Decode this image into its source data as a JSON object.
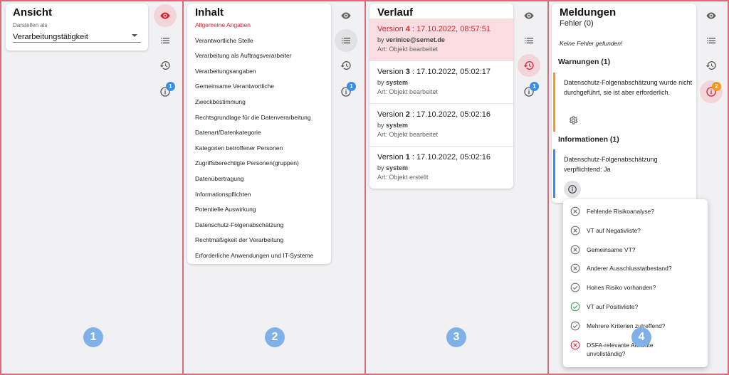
{
  "panels": [
    {
      "number": "1",
      "title": "Ansicht",
      "field_label": "Darstellen als",
      "field_value": "Verarbeitungstätigkeit"
    },
    {
      "number": "2",
      "title": "Inhalt",
      "items": [
        "Allgemeine Angaben",
        "Verantwortliche Stelle",
        "Verarbeitung als Auftragsverarbeiter",
        "Verarbeitungsangaben",
        "Gemeinsame Verantwortliche",
        "Zweckbestimmung",
        "Rechtsgrundlage für die Datenverarbeitung",
        "Datenart/Datenkategorie",
        "Kategorien betroffener Personen",
        "Zugriffsberechtigte Personen(gruppen)",
        "Datenübertragung",
        "Informationspflichten",
        "Potentielle Auswirkung",
        "Datenschutz-Folgenabschätzung",
        "Rechtmäßigkeit der Verarbeitung",
        "Erforderliche Anwendungen und IT-Systeme"
      ]
    },
    {
      "number": "3",
      "title": "Verlauf",
      "versions": [
        {
          "prefix": "Version ",
          "num": "4",
          "date": " : 17.10.2022, 08:57:51",
          "by": "by ",
          "user": "verinice@sernet.de",
          "art": "Art: Objekt bearbeitet"
        },
        {
          "prefix": "Version ",
          "num": "3",
          "date": " : 17.10.2022, 05:02:17",
          "by": "by ",
          "user": "system",
          "art": "Art: Objekt bearbeitet"
        },
        {
          "prefix": "Version ",
          "num": "2",
          "date": " : 17.10.2022, 05:02:16",
          "by": "by ",
          "user": "system",
          "art": "Art: Objekt bearbeitet"
        },
        {
          "prefix": "Version ",
          "num": "1",
          "date": " : 17.10.2022, 05:02:16",
          "by": "by ",
          "user": "system",
          "art": "Art: Objekt erstellt"
        }
      ]
    },
    {
      "number": "4",
      "title": "Meldungen",
      "errors_heading": "Fehler (0)",
      "no_errors": "Keine Fehler gefunden!",
      "warnings_heading": "Warnungen (1)",
      "warning_text": "Datenschutz-Folgenabschätzung wurde nicht durchgeführt, sie ist aber erforderlich.",
      "info_heading": "Informationen (1)",
      "info_text": "Datenschutz-Folgenabschätzung verpflichtend: Ja",
      "popup_items": [
        {
          "label": "Fehlende Risikoanalyse?",
          "state": "x-grey"
        },
        {
          "label": "VT auf Negativliste?",
          "state": "x-grey"
        },
        {
          "label": "Gemeinsame VT?",
          "state": "x-grey"
        },
        {
          "label": "Anderer Ausschlusstatbestand?",
          "state": "x-grey"
        },
        {
          "label": "Hohes Risiko vorhanden?",
          "state": "check-grey"
        },
        {
          "label": "VT auf Positivliste?",
          "state": "check-green"
        },
        {
          "label": "Mehrere Kriterien zutreffend?",
          "state": "check-grey"
        },
        {
          "label": "DSFA-relevante Attribute unvollständig?",
          "state": "x-red"
        }
      ]
    }
  ],
  "badges": {
    "info_count": "1",
    "warn_count": "2"
  },
  "colors": {
    "accent_red": "#d62330",
    "warning_orange": "#f29a1e",
    "info_blue": "#3a8ee6",
    "green": "#3aa757"
  }
}
